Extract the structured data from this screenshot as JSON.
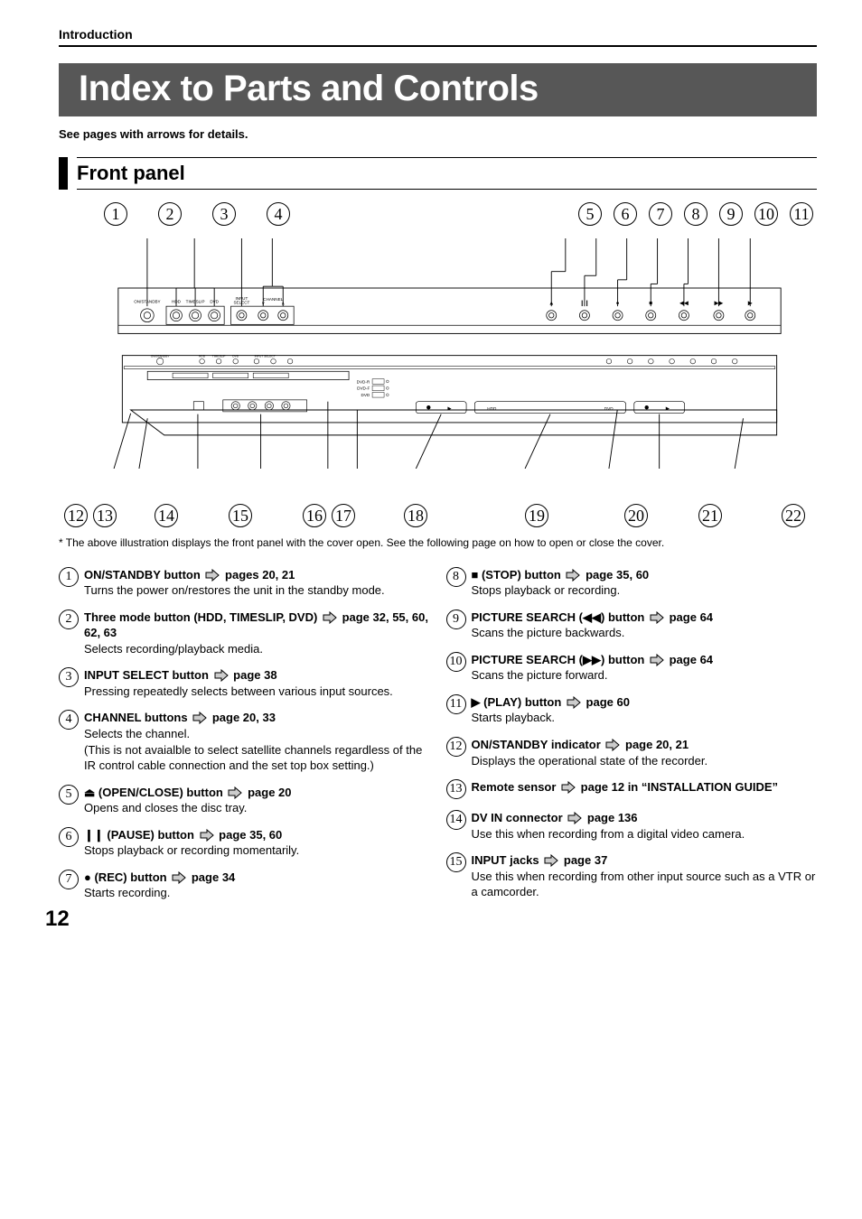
{
  "header": {
    "section_label": "Introduction",
    "title": "Index to Parts and Controls",
    "intro_line": "See pages with arrows for details.",
    "subsection": "Front panel"
  },
  "callouts_top": [
    "1",
    "2",
    "3",
    "4",
    "5",
    "6",
    "7",
    "8",
    "9",
    "10",
    "11"
  ],
  "callouts_bottom": [
    "12",
    "13",
    "14",
    "15",
    "16",
    "17",
    "18",
    "19",
    "20",
    "21",
    "22"
  ],
  "diagram_labels": {
    "on_standby": "ON/STANDBY",
    "hdd": "HDD",
    "timeslip": "TIMESLIP",
    "dvd": "DVD",
    "input_select": "INPUT\nSELECT",
    "channel": "CHANNEL"
  },
  "footnote": "* The above illustration displays the front panel with the cover open. See the following page on how to open or close the cover.",
  "items": [
    {
      "n": "1",
      "title_pre": "ON/STANDBY button ",
      "title_ref": "pages 20, 21",
      "desc": "Turns the power on/restores the unit in the standby mode."
    },
    {
      "n": "2",
      "title_pre": "Three mode button (HDD, TIMESLIP, DVD) ",
      "title_ref": "page 32, 55, 60, 62, 63",
      "desc": "Selects recording/playback media."
    },
    {
      "n": "3",
      "title_pre": "INPUT SELECT button ",
      "title_ref": "page 38",
      "desc": "Pressing repeatedly selects between various input sources."
    },
    {
      "n": "4",
      "title_pre": "CHANNEL buttons  ",
      "title_ref": "page 20, 33",
      "desc": "Selects the channel.\n(This is not avaialble to select satellite channels regardless of the IR control cable connection and the set top box setting.)"
    },
    {
      "n": "5",
      "title_sym": "⏏",
      "title_pre": " (OPEN/CLOSE) button ",
      "title_ref": "page 20",
      "desc": "Opens and closes the disc tray."
    },
    {
      "n": "6",
      "title_sym": "❙❙",
      "title_pre": " (PAUSE) button ",
      "title_ref": "page 35, 60",
      "desc": "Stops playback or recording momentarily."
    },
    {
      "n": "7",
      "title_sym": "●",
      "title_pre": " (REC) button ",
      "title_ref": "page 34",
      "desc": "Starts recording."
    },
    {
      "n": "8",
      "title_sym": "■",
      "title_pre": " (STOP) button ",
      "title_ref": "page 35, 60",
      "desc": "Stops playback or recording."
    },
    {
      "n": "9",
      "title_pre": "PICTURE SEARCH (◀◀) button ",
      "title_ref": "page 64",
      "desc": "Scans the picture backwards."
    },
    {
      "n": "10",
      "title_pre": "PICTURE SEARCH (▶▶) button ",
      "title_ref": "page 64",
      "desc": "Scans the picture forward."
    },
    {
      "n": "11",
      "title_sym": "▶",
      "title_pre": " (PLAY) button ",
      "title_ref": "page 60",
      "desc": "Starts playback."
    },
    {
      "n": "12",
      "title_pre": "ON/STANDBY indicator ",
      "title_ref": "page 20, 21",
      "desc": "Displays the operational state of the recorder."
    },
    {
      "n": "13",
      "title_pre": "Remote sensor ",
      "title_ref": "page 12 in “INSTALLATION GUIDE”",
      "desc": ""
    },
    {
      "n": "14",
      "title_pre": "DV IN connector ",
      "title_ref": "page 136",
      "desc": "Use this when recording from a digital video camera."
    },
    {
      "n": "15",
      "title_pre": "INPUT jacks ",
      "title_ref": "page 37",
      "desc": "Use this when recording from other input source such as a VTR or a camcorder."
    }
  ],
  "page_number": "12"
}
